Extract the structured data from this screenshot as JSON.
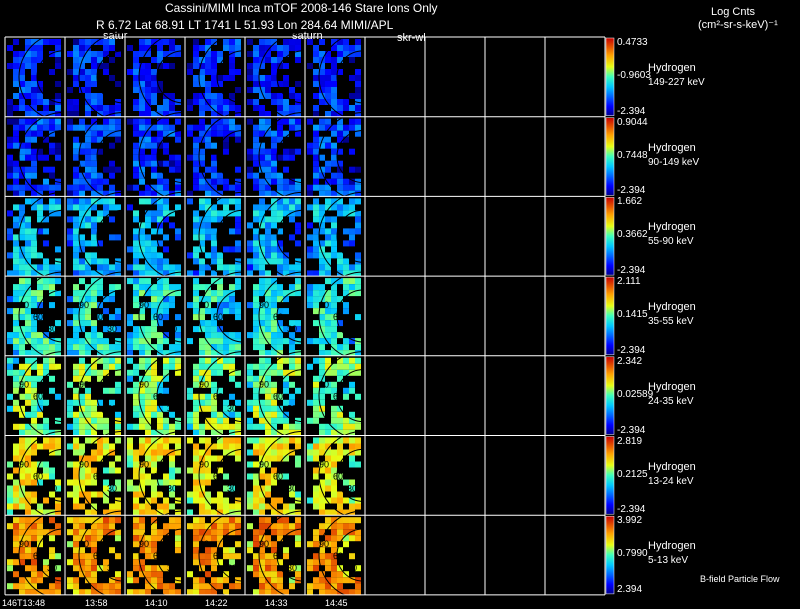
{
  "header": {
    "title": "Cassini/MIMI Inca mTOF  2008-146   Stare   Ions Only",
    "orbit_line": "R       6.72  Lat  68.91  LT 1741  L       51.93  Lon       284.64  MIMI/APL",
    "label_satur": "satur",
    "label_saturn": "saturn",
    "label_skr": "skr-wl",
    "units_line1": "Log Cnts",
    "units_line2": "(cm²-sr-s-keV)⁻¹"
  },
  "footer": {
    "note": "B-field Particle Flow"
  },
  "chart_data": {
    "type": "heatmap",
    "title": "Cassini/MIMI Inca mTOF  2008-146   Stare   Ions Only",
    "colorbar_label": "Log Cnts (cm²-sr-s-keV)⁻¹",
    "times": [
      "146T13:48",
      "13:58",
      "14:10",
      "14:22",
      "14:33",
      "14:45",
      "",
      "",
      "",
      ""
    ],
    "panels_with_data": 6,
    "channels": [
      {
        "species": "Hydrogen",
        "energy": "149-227 keV",
        "max": "0.4733",
        "mid": "-0.9603",
        "min": "-2.394",
        "level": 0.1
      },
      {
        "species": "Hydrogen",
        "energy": "90-149 keV",
        "max": "0.9044",
        "mid": "0.7448",
        "min": "-2.394",
        "level": 0.13
      },
      {
        "species": "Hydrogen",
        "energy": "55-90 keV",
        "max": "1.662",
        "mid": "0.3662",
        "min": "-2.394",
        "level": 0.28
      },
      {
        "species": "Hydrogen",
        "energy": "35-55 keV",
        "max": "2.111",
        "mid": "0.1415",
        "min": "-2.394",
        "level": 0.38
      },
      {
        "species": "Hydrogen",
        "energy": "24-35 keV",
        "max": "2.342",
        "mid": "0.02589",
        "min": "-2.394",
        "level": 0.48
      },
      {
        "species": "Hydrogen",
        "energy": "13-24 keV",
        "max": "2.819",
        "mid": "0.2125",
        "min": "-2.394",
        "level": 0.6
      },
      {
        "species": "Hydrogen",
        "energy": "5-13 keV",
        "max": "3.992",
        "mid": "0.7990",
        "min": "2.394",
        "level": 0.72
      }
    ],
    "contour_labels": [
      "90",
      "60",
      "30"
    ]
  }
}
